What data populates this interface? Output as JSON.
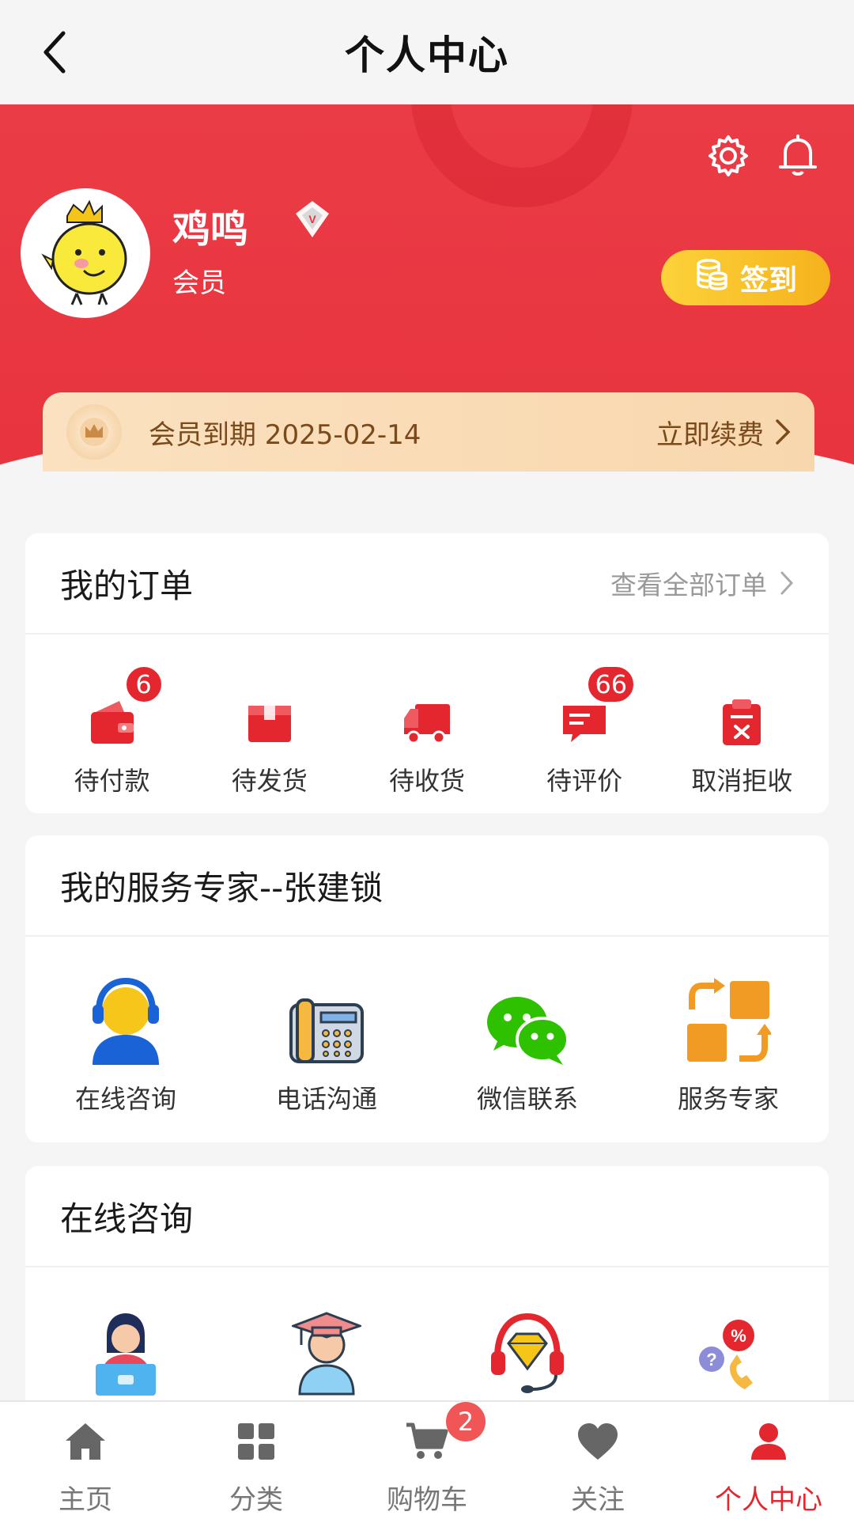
{
  "nav": {
    "title": "个人中心",
    "back_icon": "chevron-left-icon"
  },
  "profile": {
    "name": "鸡鸣",
    "level": "会员",
    "checkin_label": "签到",
    "member_expire": "会员到期 2025-02-14",
    "renew_label": "立即续费"
  },
  "orders": {
    "title": "我的订单",
    "view_all": "查看全部订单",
    "items": [
      {
        "label": "待付款",
        "icon": "wallet-icon",
        "badge": "6"
      },
      {
        "label": "待发货",
        "icon": "package-icon",
        "badge": ""
      },
      {
        "label": "待收货",
        "icon": "truck-icon",
        "badge": ""
      },
      {
        "label": "待评价",
        "icon": "comment-icon",
        "badge": "66"
      },
      {
        "label": "取消拒收",
        "icon": "clipboard-cancel-icon",
        "badge": ""
      }
    ]
  },
  "expert": {
    "title": "我的服务专家--张建锁",
    "items": [
      {
        "label": "在线咨询",
        "icon": "headset-agent-icon"
      },
      {
        "label": "电话沟通",
        "icon": "telephone-icon"
      },
      {
        "label": "微信联系",
        "icon": "wechat-icon"
      },
      {
        "label": "服务专家",
        "icon": "swap-squares-icon"
      }
    ]
  },
  "consult": {
    "title": "在线咨询",
    "items": [
      {
        "icon": "laptop-agent-icon"
      },
      {
        "icon": "graduate-icon"
      },
      {
        "icon": "diamond-headset-icon"
      },
      {
        "icon": "discount-phone-icon"
      }
    ]
  },
  "tabbar": {
    "items": [
      {
        "label": "主页",
        "icon": "home-icon"
      },
      {
        "label": "分类",
        "icon": "grid-icon"
      },
      {
        "label": "购物车",
        "icon": "cart-icon",
        "badge": "2"
      },
      {
        "label": "关注",
        "icon": "heart-icon"
      },
      {
        "label": "个人中心",
        "icon": "user-icon",
        "active": true
      }
    ]
  },
  "colors": {
    "brand_red": "#e8333e",
    "gold": "#f6b21d",
    "tab_active": "#e4262f"
  }
}
